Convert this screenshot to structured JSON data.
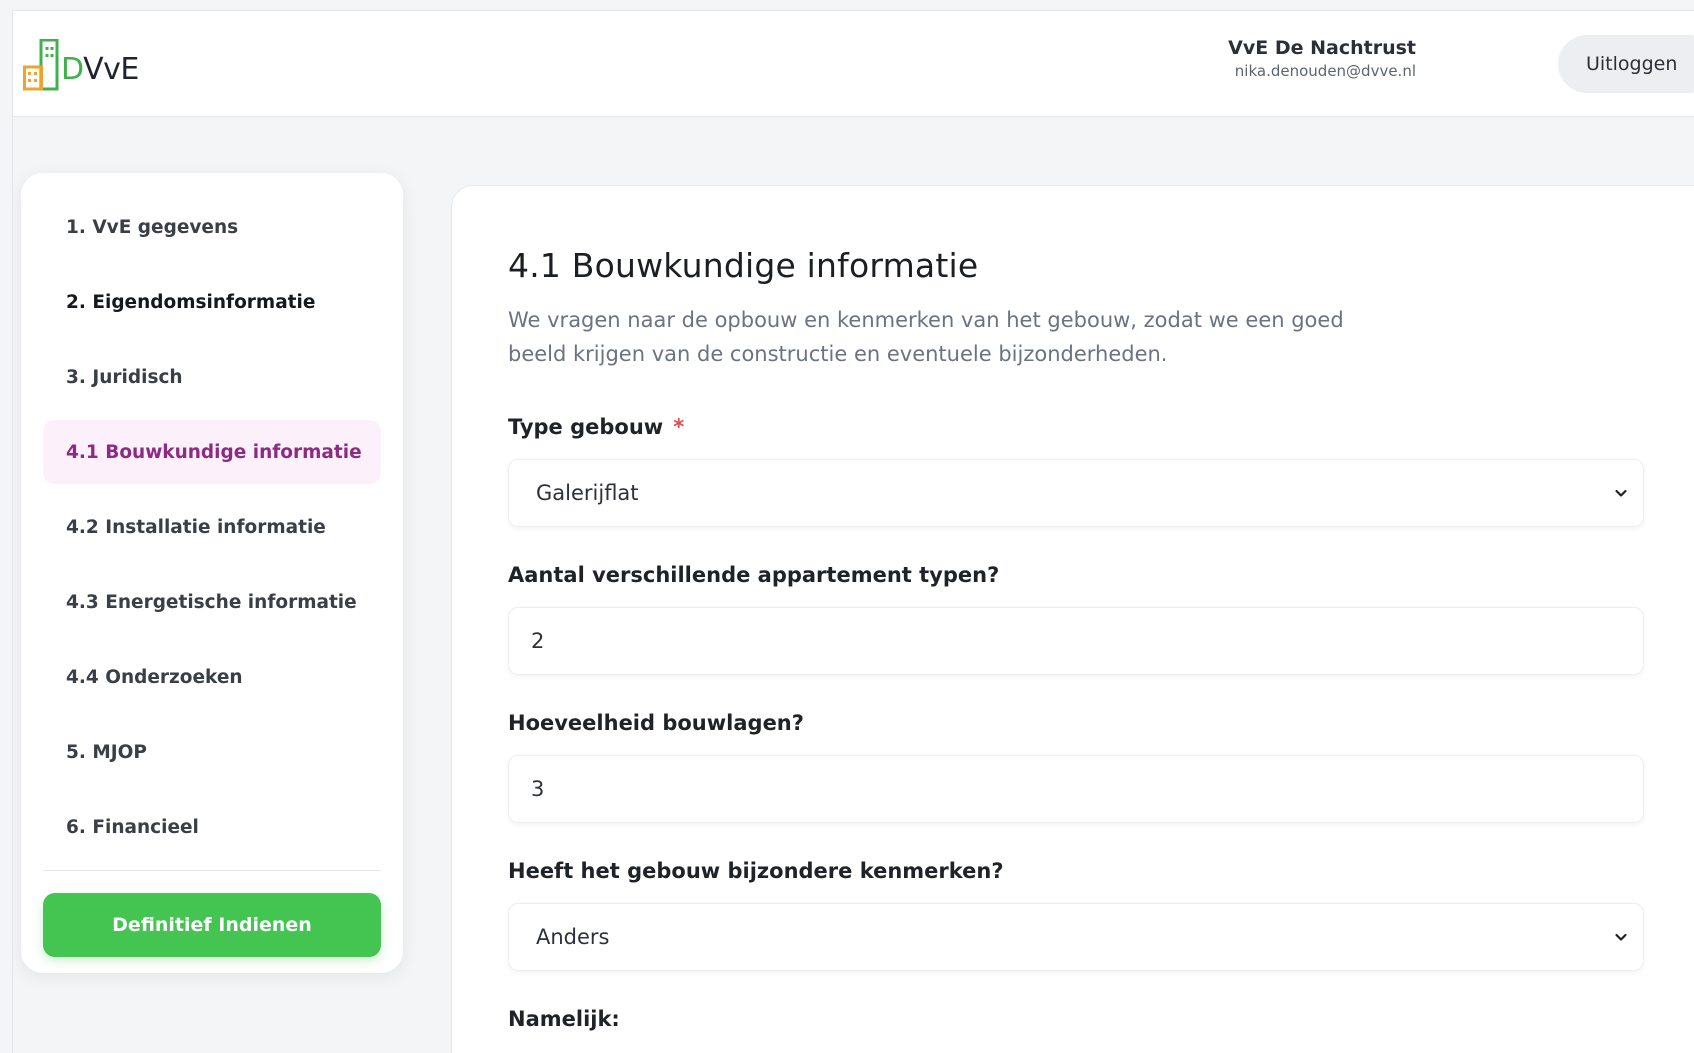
{
  "header": {
    "logo_text": "VvE",
    "logo_letter": "D",
    "user_name": "VvE De Nachtrust",
    "user_email": "nika.denouden@dvve.nl",
    "logout_label": "Uitloggen"
  },
  "sidebar": {
    "items": [
      {
        "label": "1. VvE gegevens"
      },
      {
        "label": "2. Eigendomsinformatie"
      },
      {
        "label": "3. Juridisch"
      },
      {
        "label": "4.1 Bouwkundige informatie"
      },
      {
        "label": "4.2 Installatie informatie"
      },
      {
        "label": "4.3 Energetische informatie"
      },
      {
        "label": "4.4 Onderzoeken"
      },
      {
        "label": "5. MJOP"
      },
      {
        "label": "6. Financieel"
      }
    ],
    "active_index": 3,
    "submit_label": "Definitief Indienen"
  },
  "main": {
    "title": "4.1 Bouwkundige informatie",
    "subtitle": "We vragen naar de opbouw en kenmerken van het gebouw, zodat we een goed beeld krijgen van de constructie en eventuele bijzonderheden.",
    "fields": {
      "type_gebouw": {
        "label": "Type gebouw",
        "required_mark": "*",
        "value": "Galerijflat"
      },
      "appartement_typen": {
        "label": "Aantal verschillende appartement typen?",
        "value": "2"
      },
      "bouwlagen": {
        "label": "Hoeveelheid bouwlagen?",
        "value": "3"
      },
      "kenmerken": {
        "label": "Heeft het gebouw bijzondere kenmerken?",
        "value": "Anders"
      },
      "namelijk": {
        "label": "Namelijk:"
      }
    }
  },
  "colors": {
    "accent": "#8d2a84",
    "active_bg": "#fcf0fa",
    "submit": "#44c552",
    "required": "#e5484d"
  }
}
